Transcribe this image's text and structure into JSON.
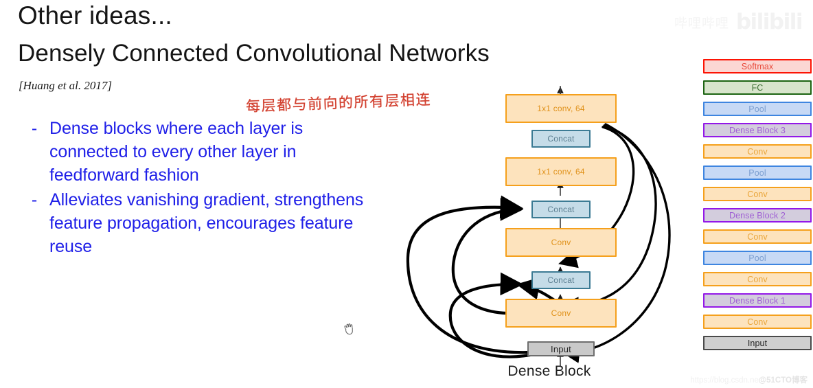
{
  "slide": {
    "heading": "Other ideas...",
    "title": "Densely Connected Convolutional Networks",
    "citation": "[Huang et al. 2017]",
    "annotation_zh": "每层都与前向的所有层相连",
    "annotation_color": "#d2402f",
    "bullet_marker": "-",
    "bullets": [
      "Dense blocks where each layer is connected to every other layer in feedforward fashion",
      "Alleviates vanishing gradient, strengthens feature propagation, encourages feature reuse"
    ],
    "bullet_color": "#2020e8"
  },
  "dense_block": {
    "caption": "Dense Block",
    "nodes": [
      {
        "label": "1x1 conv, 64",
        "kind": "conv"
      },
      {
        "label": "Concat",
        "kind": "concat"
      },
      {
        "label": "1x1 conv, 64",
        "kind": "conv"
      },
      {
        "label": "Concat",
        "kind": "concat"
      },
      {
        "label": "Conv",
        "kind": "conv"
      },
      {
        "label": "Concat",
        "kind": "concat"
      },
      {
        "label": "Conv",
        "kind": "conv"
      },
      {
        "label": "Input",
        "kind": "input"
      }
    ],
    "colors": {
      "conv_fill": "#fde3bd",
      "conv_border": "#f5a01c",
      "conv_text": "#e0921b",
      "concat_fill": "#c5dce8",
      "concat_border": "#3c7b94",
      "concat_text": "#5b7e90",
      "input_fill": "#c9c9c9",
      "input_border": "#6e6e6e"
    }
  },
  "architecture": {
    "layers": [
      {
        "label": "Softmax",
        "kind": "softmax"
      },
      {
        "label": "FC",
        "kind": "fc"
      },
      {
        "label": "Pool",
        "kind": "pool"
      },
      {
        "label": "Dense Block 3",
        "kind": "dense"
      },
      {
        "label": "Conv",
        "kind": "conv"
      },
      {
        "label": "Pool",
        "kind": "pool"
      },
      {
        "label": "Conv",
        "kind": "conv"
      },
      {
        "label": "Dense Block 2",
        "kind": "dense"
      },
      {
        "label": "Conv",
        "kind": "conv"
      },
      {
        "label": "Pool",
        "kind": "pool"
      },
      {
        "label": "Conv",
        "kind": "conv"
      },
      {
        "label": "Dense Block 1",
        "kind": "dense"
      },
      {
        "label": "Conv",
        "kind": "conv"
      },
      {
        "label": "Input",
        "kind": "input"
      }
    ],
    "colors": {
      "softmax": "#fc1404",
      "fc": "#1c6412",
      "pool": "#3e85e0",
      "dense": "#9318e8",
      "conv": "#f5a01c",
      "input": "#4a4a4a"
    }
  },
  "watermarks": {
    "bilibili_sub": "哔哩哔哩",
    "bilibili_logo": "bilibili",
    "bottom_site": "https://blog.csdn.ne",
    "bottom_blog": "@51CTO博客"
  }
}
